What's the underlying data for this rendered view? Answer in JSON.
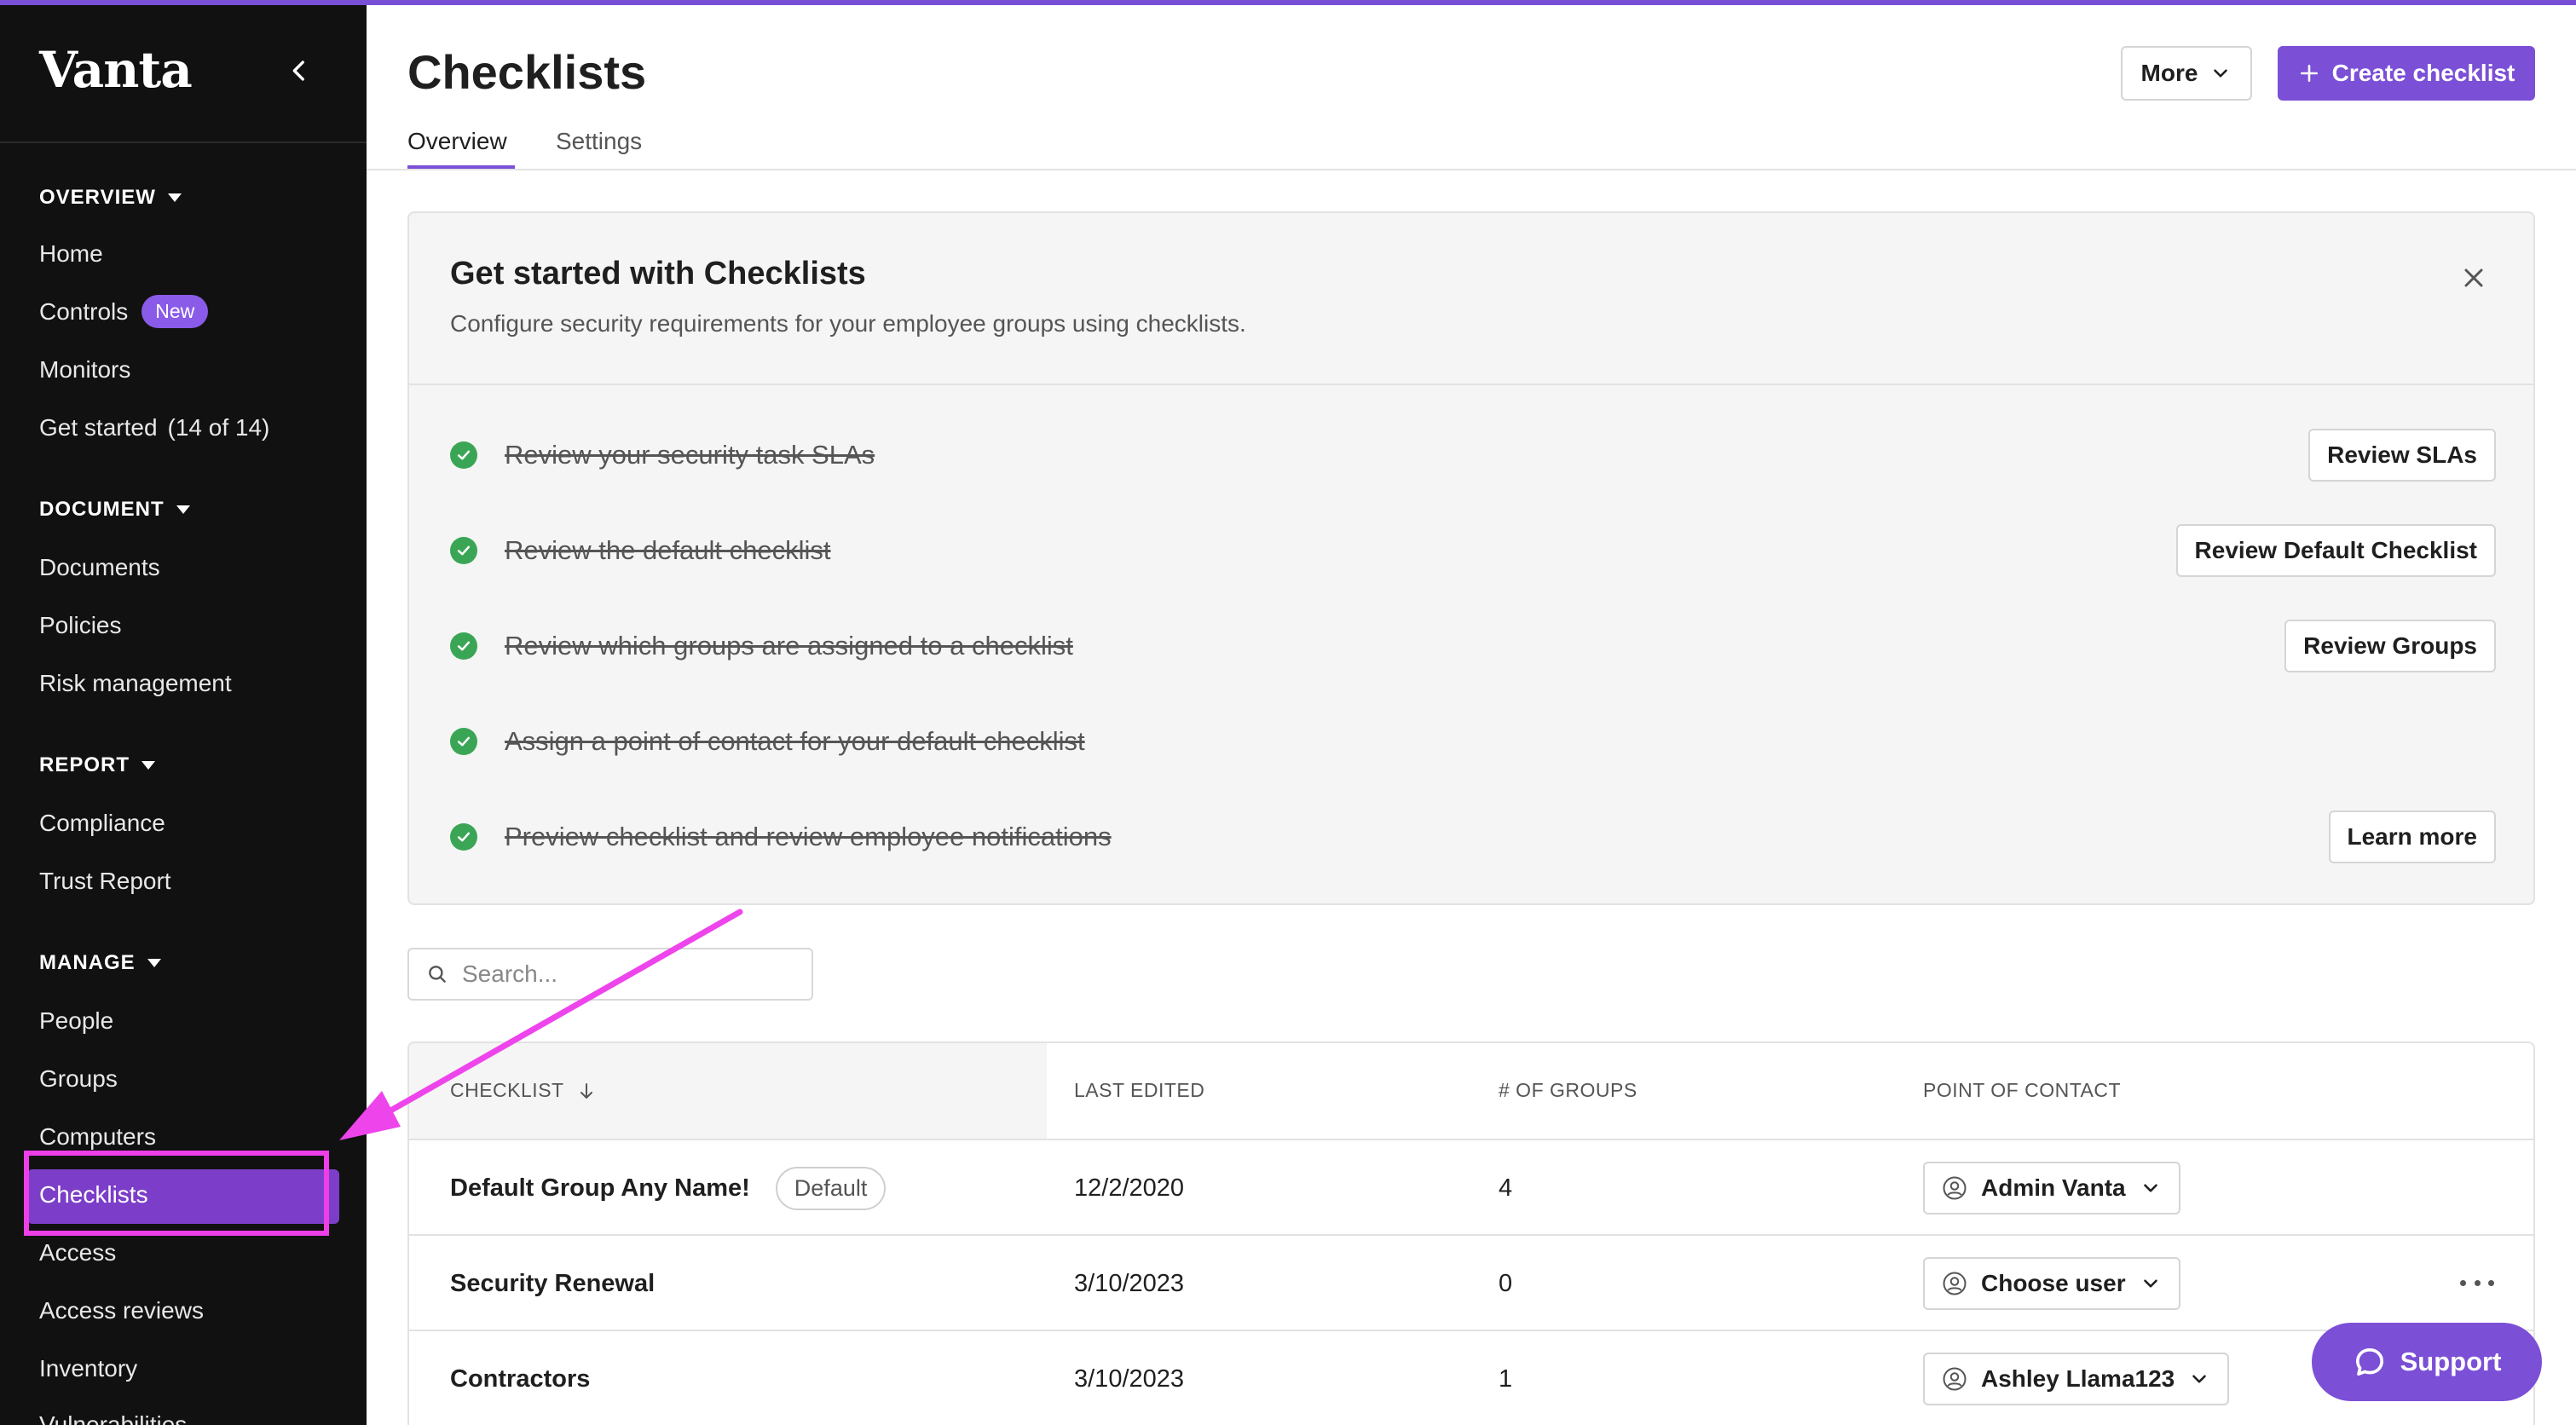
{
  "app": {
    "logo_text": "Vanta"
  },
  "colors": {
    "accent": "#7b4fd6",
    "sidebar_bg": "#111111",
    "success": "#3aa655",
    "annotation": "#ee3ee8"
  },
  "sidebar": {
    "sections": [
      {
        "title": "OVERVIEW",
        "items": [
          {
            "label": "Home"
          },
          {
            "label": "Controls",
            "badge": "New"
          },
          {
            "label": "Monitors"
          },
          {
            "label": "Get started",
            "count": "(14 of 14)"
          }
        ]
      },
      {
        "title": "DOCUMENT",
        "items": [
          {
            "label": "Documents"
          },
          {
            "label": "Policies"
          },
          {
            "label": "Risk management"
          }
        ]
      },
      {
        "title": "REPORT",
        "items": [
          {
            "label": "Compliance"
          },
          {
            "label": "Trust Report"
          }
        ]
      },
      {
        "title": "MANAGE",
        "items": [
          {
            "label": "People"
          },
          {
            "label": "Groups"
          },
          {
            "label": "Computers"
          },
          {
            "label": "Checklists",
            "active": true
          },
          {
            "label": "Access"
          },
          {
            "label": "Access reviews"
          },
          {
            "label": "Inventory"
          },
          {
            "label": "Vulnerabilities"
          }
        ]
      }
    ]
  },
  "header": {
    "title": "Checklists",
    "more_label": "More",
    "create_label": "Create checklist",
    "tabs": [
      {
        "label": "Overview",
        "active": true
      },
      {
        "label": "Settings"
      }
    ]
  },
  "get_started": {
    "title": "Get started with Checklists",
    "description": "Configure security requirements for your employee groups using checklists.",
    "tasks": [
      {
        "label": "Review your security task SLAs",
        "done": true,
        "button": "Review SLAs"
      },
      {
        "label": "Review the default checklist",
        "done": true,
        "button": "Review Default Checklist"
      },
      {
        "label": "Review which groups are assigned to a checklist",
        "done": true,
        "button": "Review Groups"
      },
      {
        "label": "Assign a point of contact for your default checklist",
        "done": true,
        "button": ""
      },
      {
        "label": "Preview checklist and review employee notifications",
        "done": true,
        "button": "Learn more"
      }
    ]
  },
  "search": {
    "placeholder": "Search..."
  },
  "table": {
    "columns": [
      "CHECKLIST",
      "LAST EDITED",
      "# OF GROUPS",
      "POINT OF CONTACT"
    ],
    "rows": [
      {
        "name": "Default Group Any Name!",
        "tag": "Default",
        "last_edited": "12/2/2020",
        "groups": "4",
        "contact": "Admin Vanta"
      },
      {
        "name": "Security Renewal",
        "tag": "",
        "last_edited": "3/10/2023",
        "groups": "0",
        "contact": "Choose user"
      },
      {
        "name": "Contractors",
        "tag": "",
        "last_edited": "3/10/2023",
        "groups": "1",
        "contact": "Ashley Llama123"
      }
    ]
  },
  "support": {
    "label": "Support"
  }
}
